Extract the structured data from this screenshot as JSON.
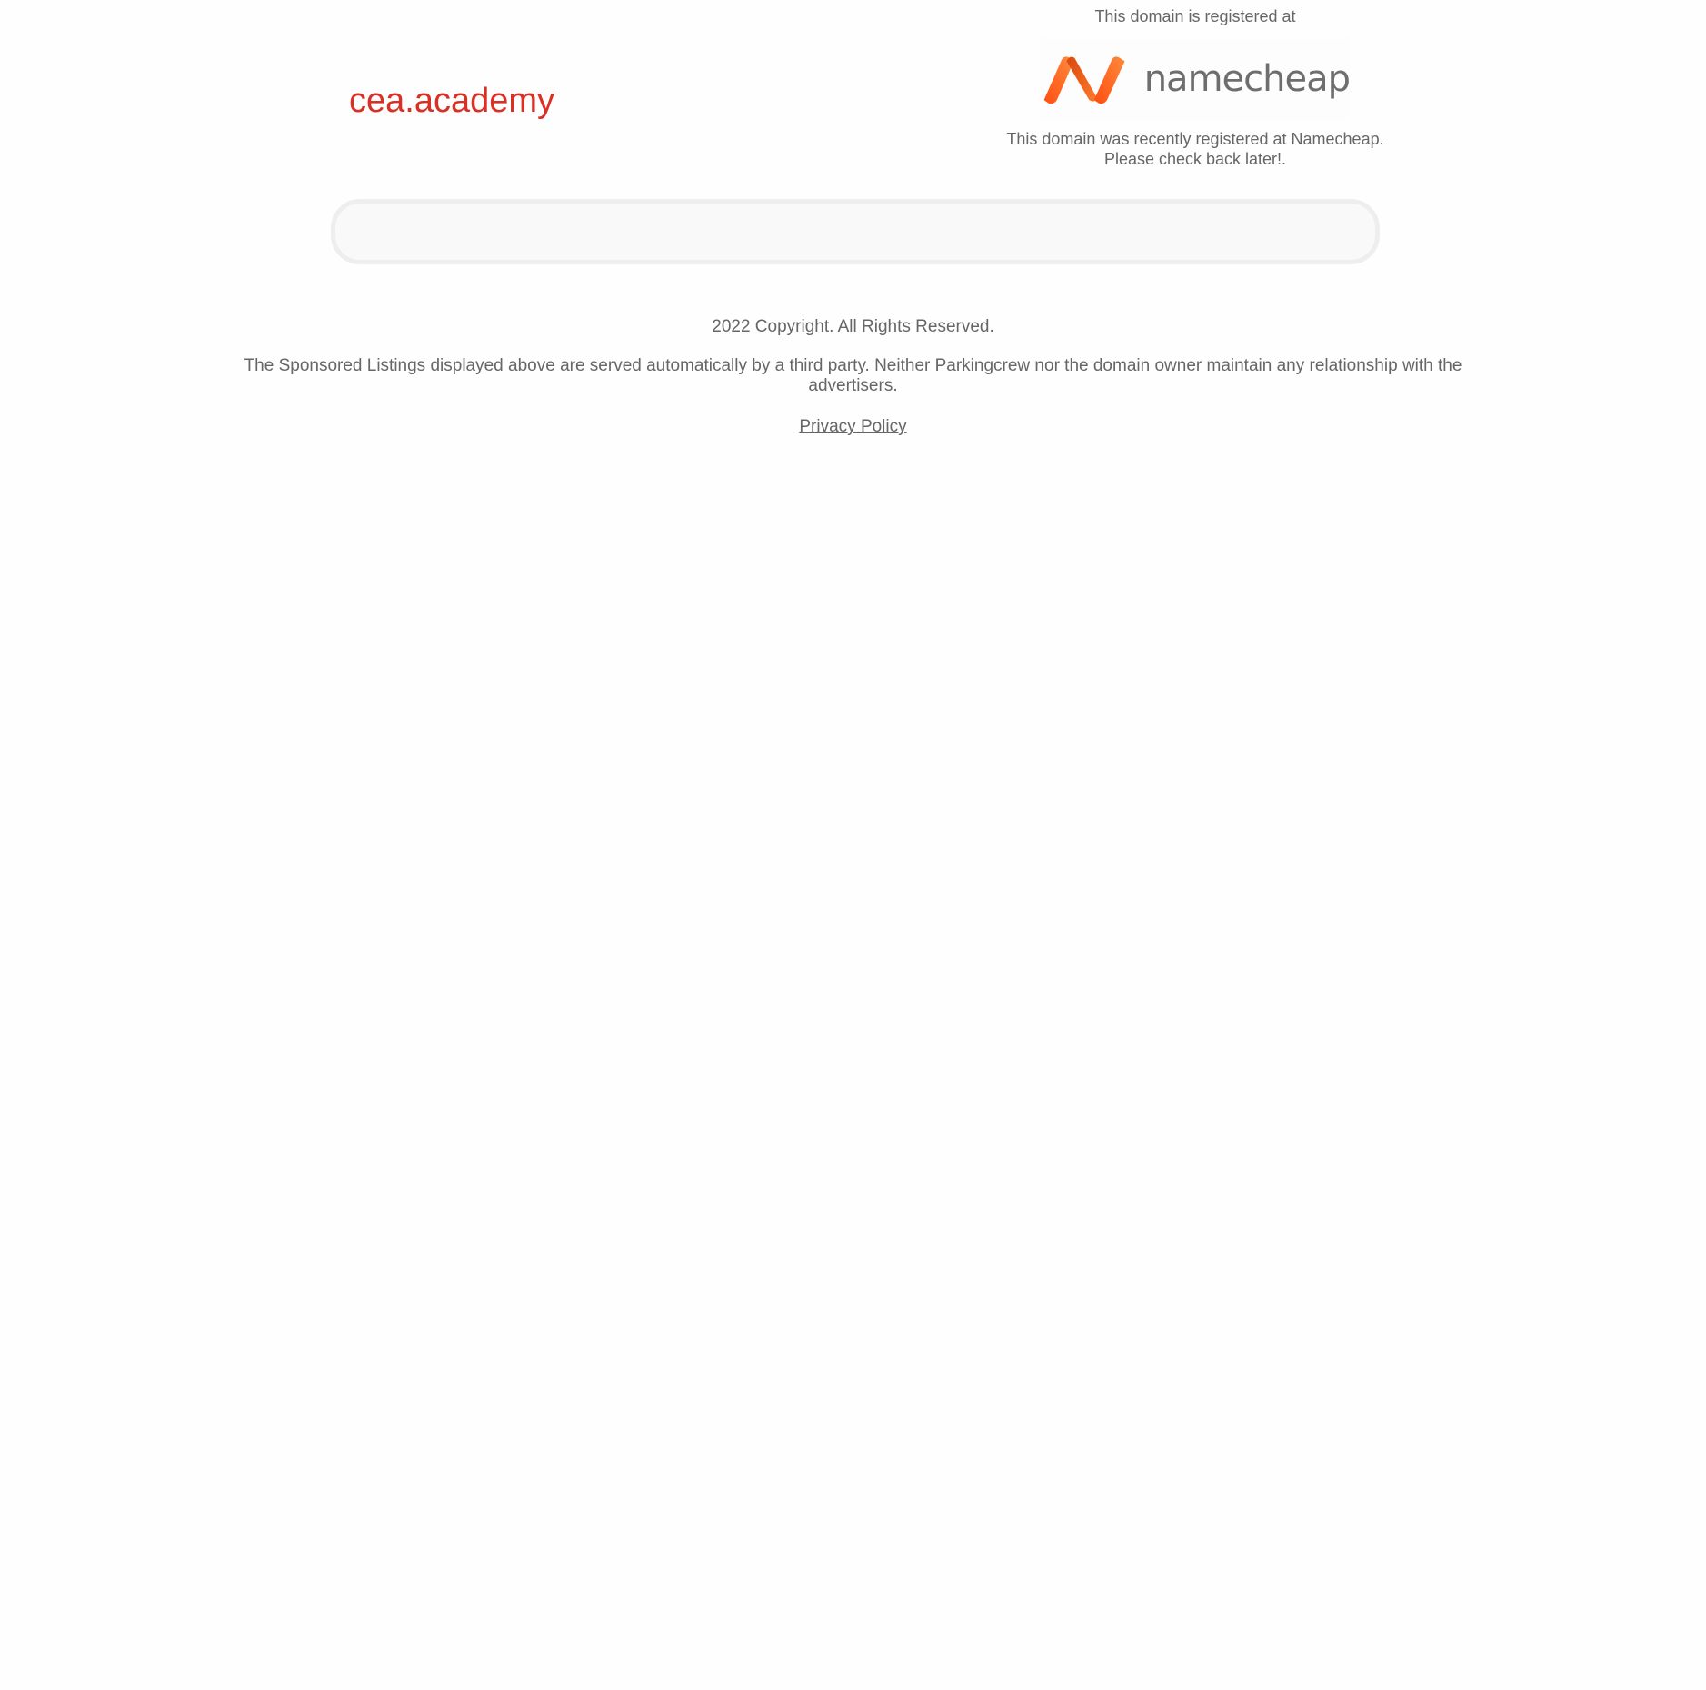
{
  "domain": {
    "name": "cea.academy"
  },
  "registrar": {
    "registered_at_text": "This domain is registered at",
    "logo_text": "namecheap",
    "logo_icon": "namecheap-n-logo",
    "recently_line1": "This domain was recently registered at Namecheap.",
    "recently_line2": "Please check back later!."
  },
  "listings": {
    "items": []
  },
  "footer": {
    "copyright": "2022 Copyright. All Rights Reserved.",
    "disclaimer": "The Sponsored Listings displayed above are served automatically by a third party. Neither Parkingcrew nor the domain owner maintain any relationship with the advertisers.",
    "privacy_label": "Privacy Policy"
  },
  "colors": {
    "domain_red": "#d93025",
    "text_gray": "#666666",
    "brand_orange": "#ff5f1f",
    "box_border": "#eeeeee"
  }
}
